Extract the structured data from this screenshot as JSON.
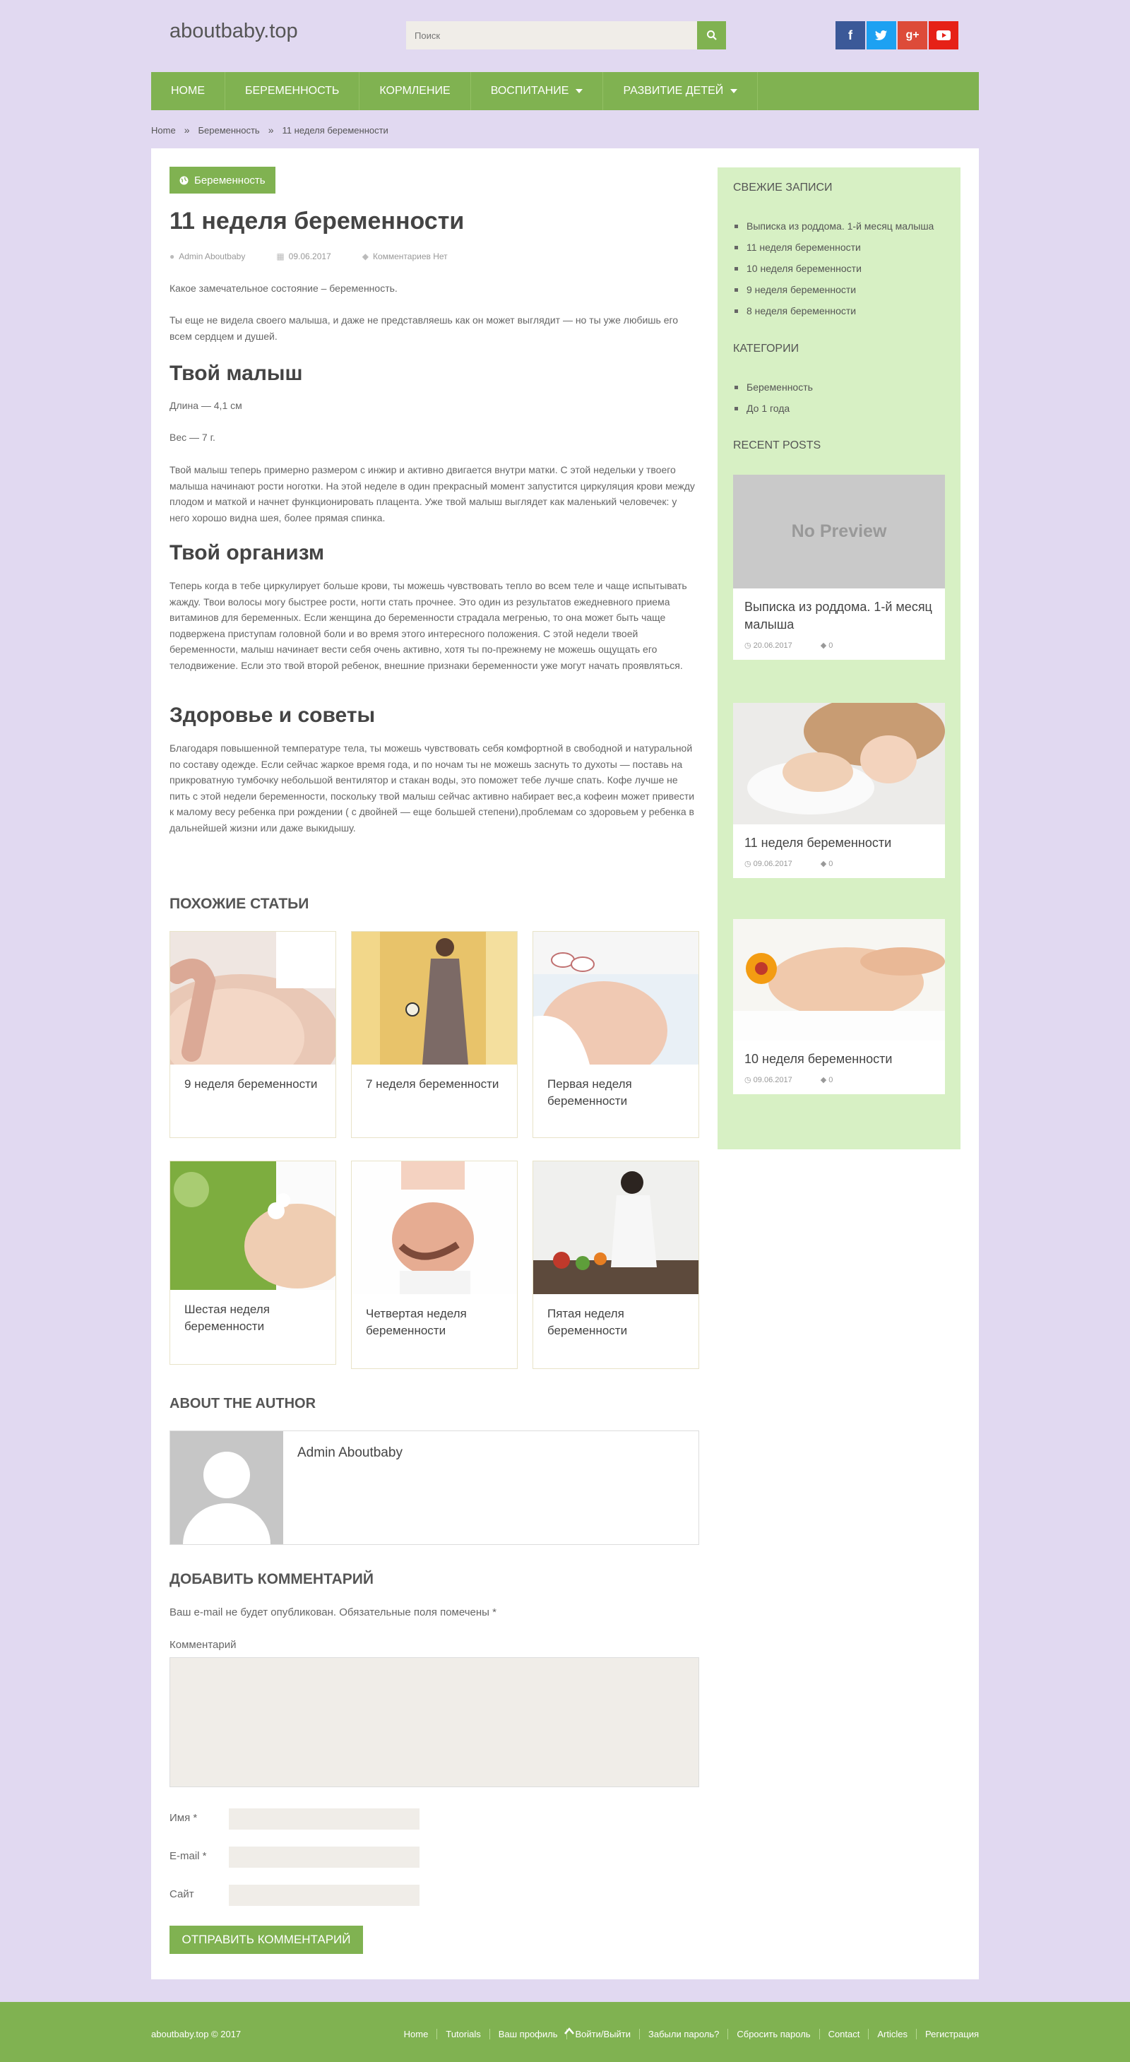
{
  "header": {
    "site_title": "aboutbaby.top",
    "search_placeholder": "Поиск",
    "social": [
      {
        "name": "facebook",
        "glyph": "f",
        "color": "#3b5998"
      },
      {
        "name": "twitter",
        "glyph": "t",
        "color": "#1da1f2"
      },
      {
        "name": "googleplus",
        "glyph": "g+",
        "color": "#dd4b39"
      },
      {
        "name": "youtube",
        "glyph": "▶",
        "color": "#e62117"
      }
    ]
  },
  "nav": [
    "HOME",
    "БЕРЕМЕННОСТЬ",
    "КОРМЛЕНИЕ",
    "ВОСПИТАНИЕ",
    "РАЗВИТИЕ ДЕТЕЙ"
  ],
  "breadcrumb": [
    "Home",
    "Беременность",
    "11 неделя беременности"
  ],
  "post": {
    "category": "Беременность",
    "title": "11 неделя беременности",
    "author": "Admin Aboutbaby",
    "date": "09.06.2017",
    "comments": "Комментариев Нет",
    "p1": "Какое замечательное состояние – беременность.",
    "p2": "Ты еще не видела своего малыша, и даже не представляешь как он может выглядит — но ты уже любишь его всем сердцем и душей.",
    "h_baby": "Твой малыш",
    "length": "Длина — 4,1 см",
    "weight": "Вес — 7 г.",
    "p3": "Твой малыш теперь примерно размером с инжир и активно двигается внутри матки. С этой недельки у твоего малыша начинают рости ноготки. На этой неделе в один прекрасный момент запустится циркуляция крови между плодом и маткой и начнет функционировать плацента. Уже твой малыш выглядет как маленький человечек: у него хорошо видна шея, более прямая спинка.",
    "h_body": "Твой организм",
    "p4": "Теперь когда в тебе циркулирует больше крови, ты можешь чувствовать тепло во всем теле и чаще испытывать жажду.  Твои волосы могу быстрее рости, ногти стать прочнее. Это один из результатов ежедневного приема витаминов для беременных. Если женщина до беременности страдала мегренью, то она может быть чаще подвержена приступам головной боли и во время этого интересного положения. С этой недели твоей беременности, малыш начинает вести себя очень активно, хотя ты по-прежнему не можешь ощущать его телодвижение. Если это твой второй ребенок, внешние признаки беременности уже могут начать проявляться.",
    "h_health": "Здоровье и советы",
    "p5": "Благодаря повышенной температуре тела, ты можешь чувствовать себя комфортной в свободной и натуральной по составу одежде. Если сейчас жаркое время года, и по ночам ты не можешь заснуть то духоты — поставь на прикроватную тумбочку небольшой вентилятор и стакан воды, это поможет тебе лучше спать. Кофе лучше не пить с этой недели беременности, поскольку твой малыш сейчас активно набирает вес,а кофеин может привести к малому весу ребенка при рождении ( с двойней — еще большей степени),проблемам со здоровьем у ребенка в дальнейшей жизни или даже выкидышу."
  },
  "related": {
    "heading": "ПОХОЖИЕ СТАТЬИ",
    "items": [
      {
        "title": "9 неделя беременности"
      },
      {
        "title": "7 неделя беременности"
      },
      {
        "title": "Первая неделя беременности"
      },
      {
        "title": "Шестая неделя беременности"
      },
      {
        "title": "Четвертая неделя беременности"
      },
      {
        "title": "Пятая неделя беременности"
      }
    ]
  },
  "author_box": {
    "heading": "ABOUT THE AUTHOR",
    "name": "Admin Aboutbaby"
  },
  "comment_form": {
    "heading": "ДОБАВИТЬ КОММЕНТАРИЙ",
    "note": "Ваш e-mail не будет опубликован. Обязательные поля помечены *",
    "comment_label": "Комментарий",
    "name_label": "Имя *",
    "email_label": "E-mail *",
    "site_label": "Сайт",
    "submit": "ОТПРАВИТЬ КОММЕНТАРИЙ"
  },
  "sidebar": {
    "recent_heading": "СВЕЖИЕ ЗАПИСИ",
    "recent": [
      "Выписка из роддома. 1-й месяц малыша",
      "11 неделя беременности",
      "10 неделя беременности",
      "9 неделя беременности",
      "8 неделя беременности"
    ],
    "categories_heading": "КАТЕГОРИИ",
    "categories": [
      "Беременность",
      "До 1 года"
    ],
    "recent_posts_heading": "RECENT POSTS",
    "no_preview": "No Preview",
    "posts": [
      {
        "title": "Выписка из роддома. 1-й месяц малыша",
        "date": "20.06.2017",
        "comments": "0"
      },
      {
        "title": "11 неделя беременности",
        "date": "09.06.2017",
        "comments": "0"
      },
      {
        "title": "10 неделя беременности",
        "date": "09.06.2017",
        "comments": "0"
      }
    ]
  },
  "footer": {
    "copyright": "aboutbaby.top © 2017",
    "links": [
      "Home",
      "Tutorials",
      "Ваш профиль",
      "Войти/Выйти",
      "Забыли пароль?",
      "Сбросить пароль",
      "Contact",
      "Articles",
      "Регистрация"
    ]
  },
  "colors": {
    "accent": "#80b251",
    "page_bg": "#e1d9f1",
    "sidebar_bg": "#d7f0c4"
  }
}
